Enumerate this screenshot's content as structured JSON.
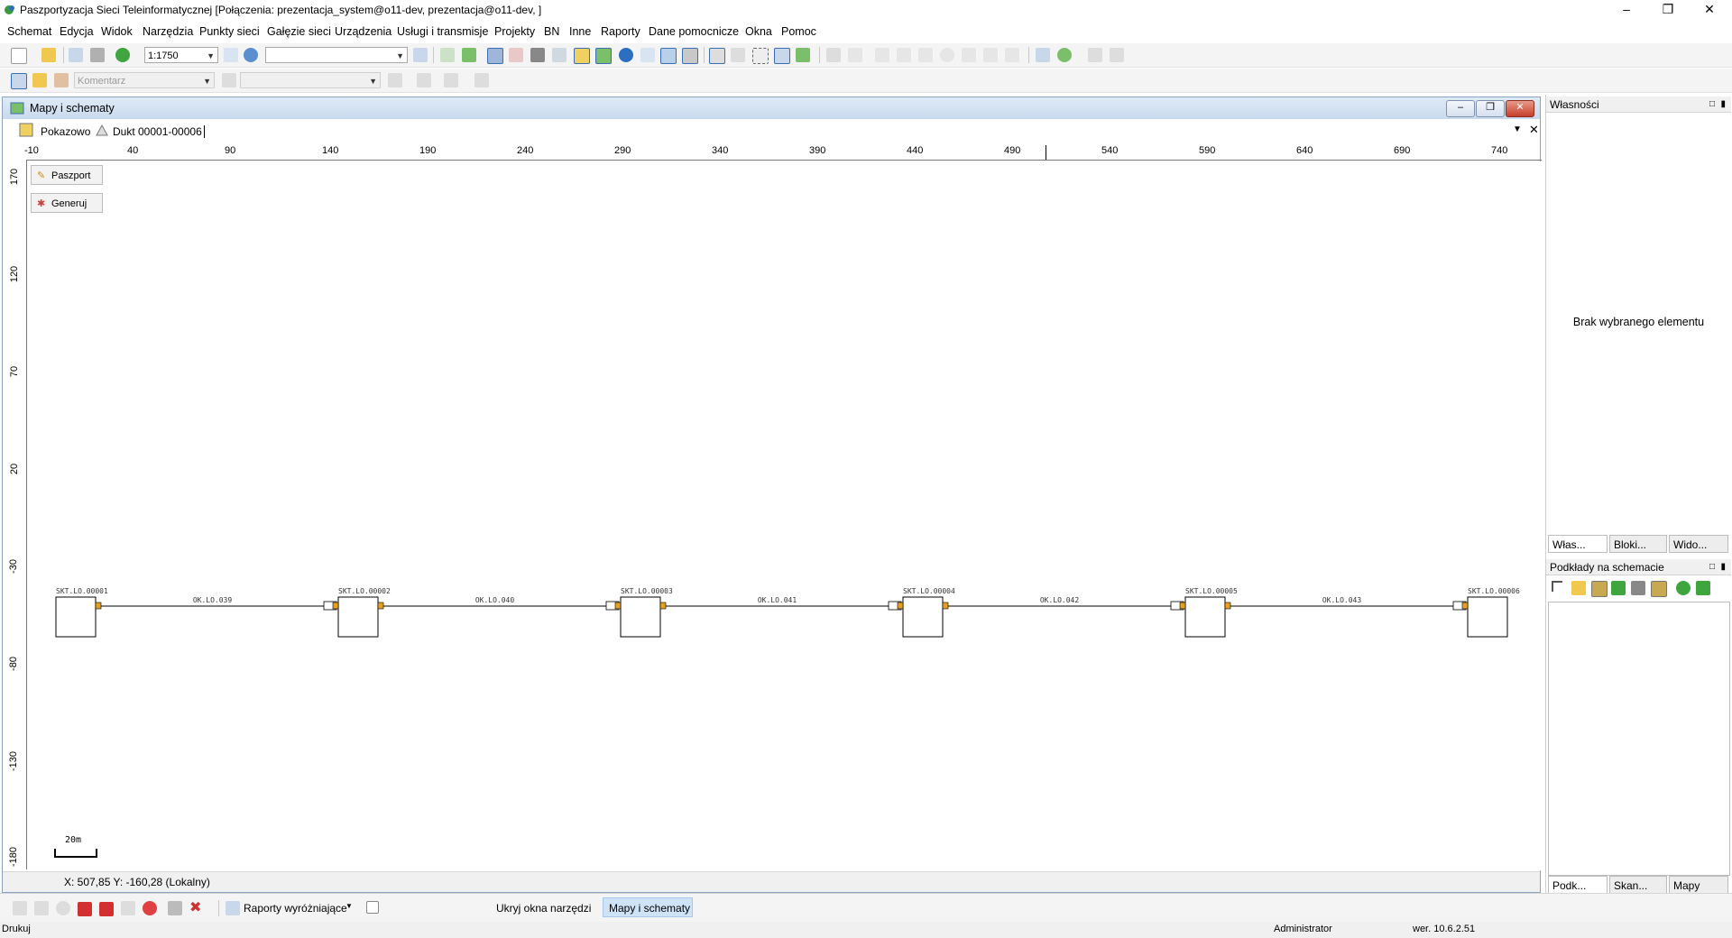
{
  "window": {
    "title": "Paszportyzacja Sieci Teleinformatycznej [Połączenia: prezentacja_system@o11-dev, prezentacja@o11-dev, ]",
    "minimize": "–",
    "maximize": "❐",
    "close": "✕"
  },
  "menu": [
    "Schemat",
    "Edycja",
    "Widok",
    "Narzędzia",
    "Punkty sieci",
    "Gałęzie sieci",
    "Urządzenia",
    "Usługi i transmisje",
    "Projekty",
    "BN",
    "Inne",
    "Raporty",
    "Dane pomocnicze",
    "Okna",
    "Pomoc"
  ],
  "toolbar": {
    "scale": "1:1750",
    "search_combo": "",
    "comment_placeholder": "Komentarz",
    "second_combo": ""
  },
  "mdi": {
    "title": "Mapy i schematy",
    "tab_mode": "Pokazowo",
    "tab_doc": "Dukt 00001-00006",
    "btn_paszport": "Paszport",
    "btn_generuj": "Generuj",
    "ruler_top": [
      "-10",
      "40",
      "90",
      "140",
      "190",
      "240",
      "290",
      "340",
      "390",
      "440",
      "490",
      "540",
      "590",
      "640",
      "690",
      "740"
    ],
    "ruler_left": [
      "170",
      "120",
      "70",
      "20",
      "-30",
      "-80",
      "-130",
      "-180"
    ],
    "scale_bar": "20m",
    "coords": "X: 507,85  Y: -160,28 (Lokalny)"
  },
  "schema": {
    "nodes": [
      "SKT.LO.00001",
      "SKT.LO.00002",
      "SKT.LO.00003",
      "SKT.LO.00004",
      "SKT.LO.00005",
      "SKT.LO.00006"
    ],
    "links": [
      "OK.LO.039",
      "OK.LO.040",
      "OK.LO.041",
      "OK.LO.042",
      "OK.LO.043"
    ]
  },
  "right_panel": {
    "props_title": "Własności",
    "empty_text": "Brak wybranego elementu",
    "tabs_top": [
      "Włas...",
      "Bloki...",
      "Wido..."
    ],
    "layers_title": "Podkłady na schemacie",
    "tabs_bottom": [
      "Podk...",
      "Skan...",
      "Mapy"
    ]
  },
  "bottom": {
    "reports": "Raporty wyróżniające",
    "hide_tools": "Ukryj okna narzędzi",
    "maps_tab": "Mapy i schematy"
  },
  "status": {
    "left": "Drukuj",
    "user": "Administrator",
    "version": "wer. 10.6.2.51"
  },
  "colors": {
    "accent": "#c9daee",
    "close": "#c6402b",
    "connector": "#e6a020"
  }
}
